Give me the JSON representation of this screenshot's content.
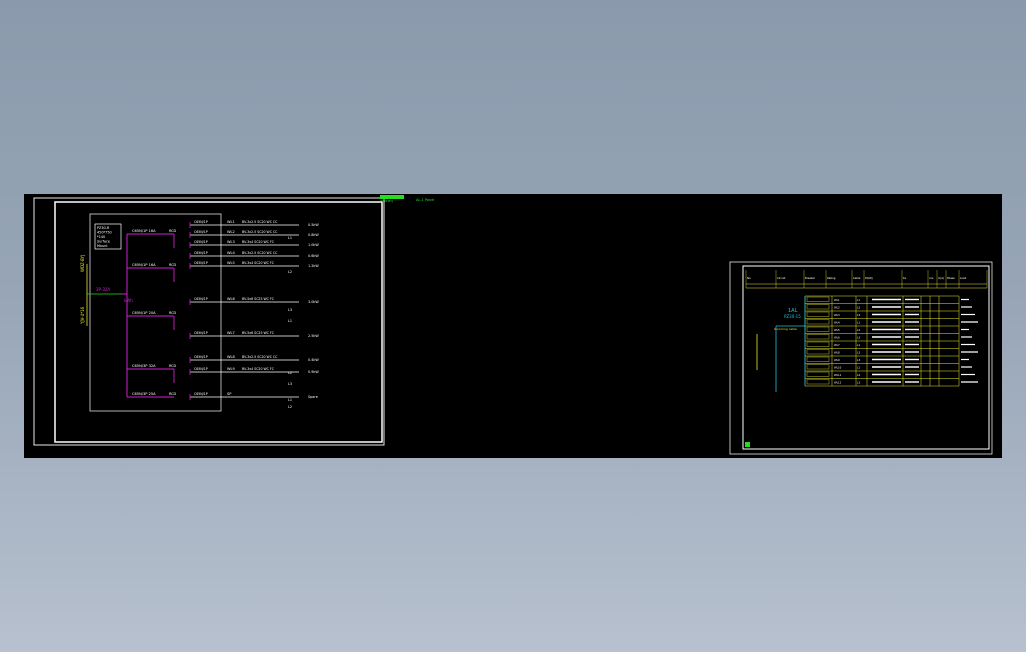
{
  "window": {
    "colors": {
      "background_top": "#8a9aac",
      "background_bottom": "#b7c1cf",
      "model_space": "#000000",
      "magenta": "#d020d0",
      "white": "#ffffff",
      "yellow": "#e8e830",
      "green": "#20e020",
      "cyan": "#20c0e0"
    }
  },
  "left_sheet": {
    "panel_note_lines": [
      "PZ30-R",
      "450*750",
      "*140",
      "Surface",
      "Mount"
    ],
    "incoming_label": "3P-32A",
    "incoming_feed": "WDZ-BYJ",
    "feeder_cable": "YJV-4*16",
    "meter_tag": "kWh",
    "breakers": [
      {
        "rating": "C65N/1P 16A",
        "tag": "RCD"
      },
      {
        "rating": "C65N/1P 16A",
        "tag": "RCD"
      },
      {
        "rating": "C65N/1P 20A",
        "tag": "RCD"
      },
      {
        "rating": "C65N/3P 32A",
        "tag": "RCD"
      },
      {
        "rating": "C65N/3P 25A",
        "tag": "RCD"
      }
    ],
    "circuits": [
      {
        "id": "WL1",
        "cable": "BV-3x2.5 SC20 WC CC",
        "load": "0.5kW"
      },
      {
        "id": "WL2",
        "cable": "BV-3x2.5 SC20 WC CC",
        "load": "0.8kW"
      },
      {
        "id": "WL3",
        "cable": "BV-3x4 SC20 WC FC",
        "load": "1.0kW"
      },
      {
        "id": "WL4",
        "cable": "BV-3x2.5 SC20 WC CC",
        "load": "0.6kW"
      },
      {
        "id": "WL5",
        "cable": "BV-3x4 SC20 WC FC",
        "load": "1.2kW"
      },
      {
        "id": "WL6",
        "cable": "BV-5x6 SC25 WC FC",
        "load": "3.0kW"
      },
      {
        "id": "WL7",
        "cable": "BV-5x6 SC25 WC FC",
        "load": "2.5kW"
      },
      {
        "id": "WL8",
        "cable": "BV-3x2.5 SC20 WC CC",
        "load": "0.4kW"
      },
      {
        "id": "WL9",
        "cable": "BV-3x4 SC20 WC FC",
        "load": "0.9kW"
      },
      {
        "id": "SP",
        "cable": "",
        "load": "Spare"
      }
    ]
  },
  "left_sheet_tags": [
    "L1",
    "L2",
    "L3",
    "L1",
    "L2",
    "L3",
    "L1",
    "L2"
  ],
  "top_labels": {
    "a": "WDZ-BYJ",
    "b": "AL-1 Panel"
  },
  "right_sheet": {
    "columns": [
      "No.",
      "Circuit",
      "Breaker",
      "Rating",
      "Cable",
      "P(kW)",
      "Kx",
      "cos",
      "Ic(A)",
      "Phase",
      "Load"
    ],
    "panel_tag": "1AL",
    "panel_sub": "PZ30-15",
    "incoming_label": "Incoming cable",
    "row_count": 12
  }
}
